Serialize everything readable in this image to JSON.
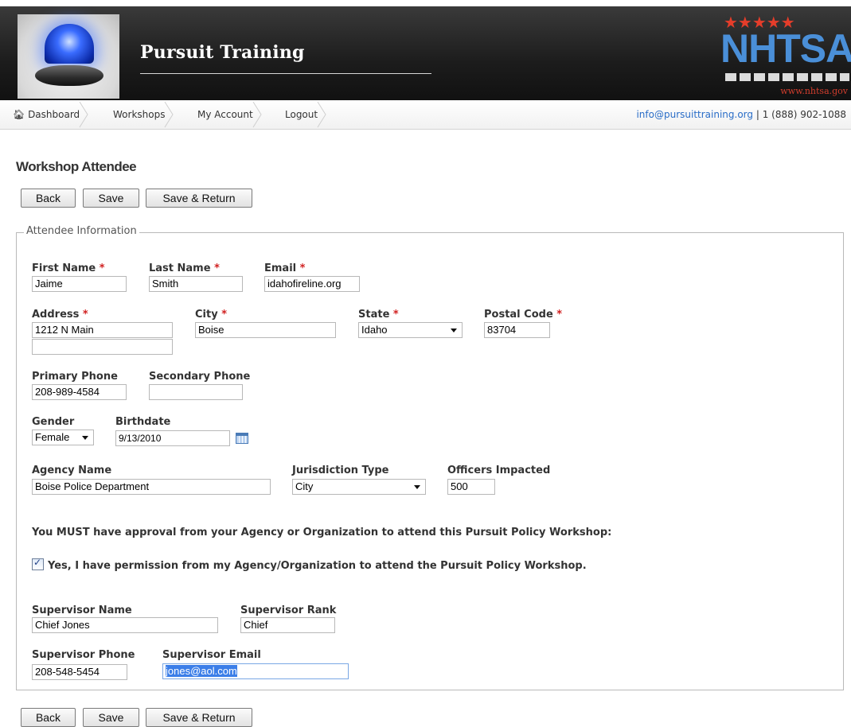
{
  "header": {
    "app_title": "Pursuit Training",
    "logo_text": "NHTSA",
    "logo_url": "www.nhtsa.gov",
    "stars": "★★★★★"
  },
  "nav": {
    "items": [
      {
        "label": "Dashboard",
        "icon": "home-icon"
      },
      {
        "label": "Workshops"
      },
      {
        "label": "My Account"
      },
      {
        "label": "Logout"
      }
    ],
    "contact_email": "info@pursuittraining.org",
    "contact_sep": " | ",
    "contact_phone": "1 (888) 902-1088"
  },
  "page": {
    "title": "Workshop Attendee",
    "buttons": {
      "back": "Back",
      "save": "Save",
      "save_return": "Save & Return"
    },
    "legend": "Attendee Information"
  },
  "form": {
    "first_name": {
      "label": "First Name",
      "value": "Jaime"
    },
    "last_name": {
      "label": "Last Name",
      "value": "Smith"
    },
    "email": {
      "label": "Email",
      "value": "idahofireline.org"
    },
    "address": {
      "label": "Address",
      "value": "1212 N Main",
      "value2": ""
    },
    "city": {
      "label": "City",
      "value": "Boise"
    },
    "state": {
      "label": "State",
      "value": "Idaho"
    },
    "postal": {
      "label": "Postal Code",
      "value": "83704"
    },
    "primary_phone": {
      "label": "Primary Phone",
      "value": "208-989-4584"
    },
    "secondary_phone": {
      "label": "Secondary Phone",
      "value": ""
    },
    "gender": {
      "label": "Gender",
      "value": "Female"
    },
    "birthdate": {
      "label": "Birthdate",
      "value": "9/13/2010"
    },
    "agency": {
      "label": "Agency Name",
      "value": "Boise Police Department"
    },
    "jurisdiction": {
      "label": "Jurisdiction Type",
      "value": "City"
    },
    "officers": {
      "label": "Officers Impacted",
      "value": "500"
    },
    "notice": "You MUST have approval from your Agency or Organization to attend this Pursuit Policy Workshop:",
    "permission": {
      "label": "Yes, I have permission from my Agency/Organization to attend the Pursuit Policy Workshop.",
      "checked": true
    },
    "sup_name": {
      "label": "Supervisor Name",
      "value": "Chief Jones"
    },
    "sup_rank": {
      "label": "Supervisor Rank",
      "value": "Chief"
    },
    "sup_phone": {
      "label": "Supervisor Phone",
      "value": "208-548-5454"
    },
    "sup_email": {
      "label": "Supervisor Email",
      "value": "jones@aol.com"
    },
    "required_mark": "*"
  },
  "colors": {
    "required": "#d12020",
    "link": "#2a6dc7",
    "selection": "#3b7ee8"
  }
}
